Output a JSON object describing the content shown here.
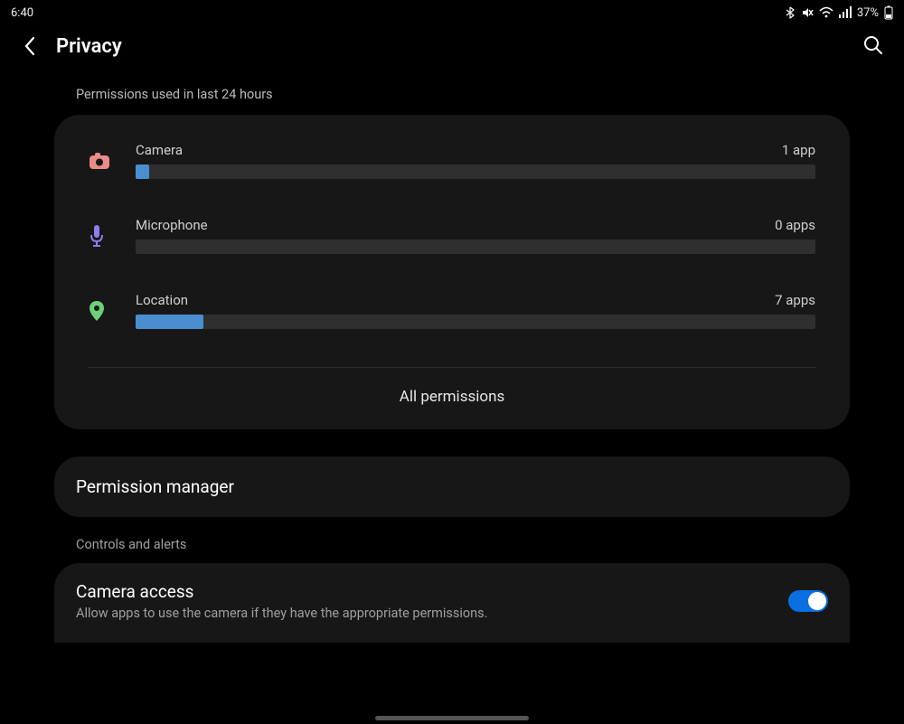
{
  "status": {
    "time": "6:40",
    "battery_pct": "37%"
  },
  "header": {
    "title": "Privacy"
  },
  "usage": {
    "section_label": "Permissions used in last 24 hours",
    "rows": [
      {
        "label": "Camera",
        "count": "1 app",
        "fill_pct": 2,
        "icon": "camera",
        "icon_color": "#e98b88"
      },
      {
        "label": "Microphone",
        "count": "0 apps",
        "fill_pct": 0,
        "icon": "mic",
        "icon_color": "#8f7ded"
      },
      {
        "label": "Location",
        "count": "7 apps",
        "fill_pct": 10,
        "icon": "location",
        "icon_color": "#6bd17a"
      }
    ],
    "all_permissions_label": "All permissions"
  },
  "permission_manager": {
    "label": "Permission manager"
  },
  "controls": {
    "section_label": "Controls and alerts",
    "camera_access": {
      "title": "Camera access",
      "subtitle": "Allow apps to use the camera if they have the appropriate permissions.",
      "enabled": true
    }
  }
}
